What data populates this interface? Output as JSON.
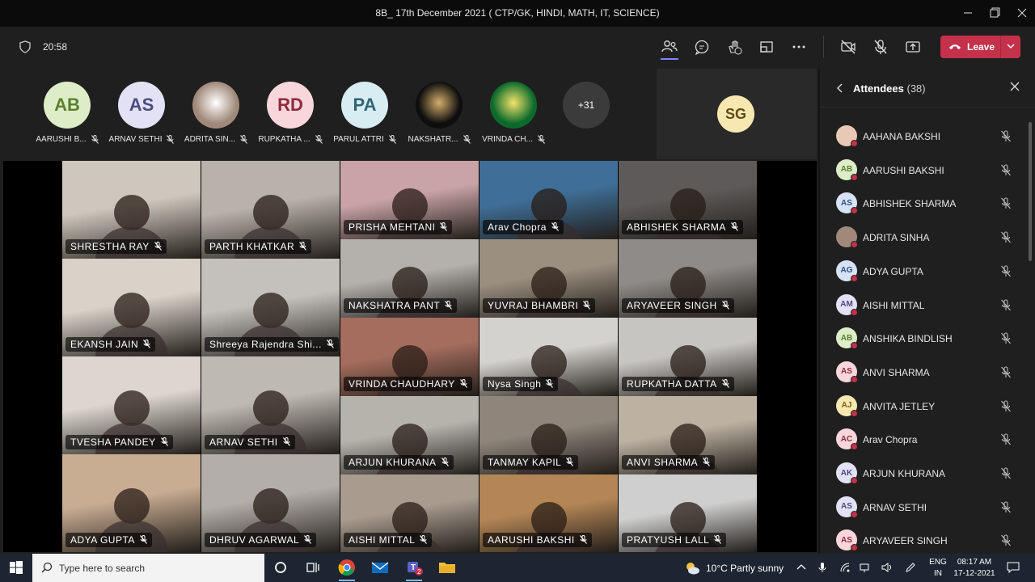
{
  "window": {
    "title": "8B_ 17th December 2021 ( CTP/GK, HINDI, MATH, IT, SCIENCE)"
  },
  "toolbar": {
    "timer": "20:58",
    "leave_label": "Leave"
  },
  "strip": {
    "participants": [
      {
        "initials": "AB",
        "name": "AARUSHI B...",
        "bg": "#dcedc8",
        "fg": "#5a7f2e",
        "photo": false
      },
      {
        "initials": "AS",
        "name": "ARNAV SETHI",
        "bg": "#e3e1f5",
        "fg": "#4b4c7d",
        "photo": false
      },
      {
        "initials": "",
        "name": "ADRITA SIN...",
        "bg": "#a0897a",
        "fg": "#ffffff",
        "photo": true
      },
      {
        "initials": "RD",
        "name": "RUPKATHA ...",
        "bg": "#f9d6dc",
        "fg": "#8c2a3c",
        "photo": false
      },
      {
        "initials": "PA",
        "name": "PARUL ATTRI",
        "bg": "#d7edf2",
        "fg": "#326574",
        "photo": false
      },
      {
        "initials": "",
        "name": "NAKSHATR...",
        "bg": "#0e0e0e",
        "fg": "#d4ad6a",
        "photo": true
      },
      {
        "initials": "",
        "name": "VRINDA CH...",
        "bg": "#0c6a2c",
        "fg": "#f4e36a",
        "photo": true
      }
    ],
    "more_count": "+31",
    "self_initials": "SG"
  },
  "tiles": [
    {
      "name": "SHRESTHA RAY",
      "bg": "#cfc7bd"
    },
    {
      "name": "PARTH KHATKAR",
      "bg": "#b9b2ab"
    },
    {
      "name": "PRISHA MEHTANI",
      "bg": "#c9a3a6"
    },
    {
      "name": "Arav Chopra",
      "bg": "#3f6f98"
    },
    {
      "name": "ABHISHEK SHARMA",
      "bg": "#5d5a59"
    },
    {
      "name": "EKANSH JAIN",
      "bg": "#d8d2c8"
    },
    {
      "name": "Shreeya Rajendra Shi...",
      "bg": "#c4c0bb"
    },
    {
      "name": "NAKSHATRA PANT",
      "bg": "#b4b0ab"
    },
    {
      "name": "YUVRAJ BHAMBRI",
      "bg": "#9b8f80"
    },
    {
      "name": "ARYAVEER SINGH",
      "bg": "#8e8b88"
    },
    {
      "name": "VRINDA CHAUDHARY",
      "bg": "#a56d5d"
    },
    {
      "name": "Nysa Singh",
      "bg": "#d4d2ce"
    },
    {
      "name": "RUPKATHA DATTA",
      "bg": "#c7c5c2"
    },
    {
      "name": "TVESHA PANDEY",
      "bg": "#dcd6cf"
    },
    {
      "name": "ARNAV SETHI",
      "bg": "#bfb9b3"
    },
    {
      "name": "ARJUN KHURANA",
      "bg": "#b6b3ad"
    },
    {
      "name": "TANMAY KAPIL",
      "bg": "#8f857b"
    },
    {
      "name": "ANVI SHARMA",
      "bg": "#bdb1a2"
    },
    {
      "name": "ADYA GUPTA",
      "bg": "#c9ad93"
    },
    {
      "name": "DHRUV AGARWAL",
      "bg": "#b3aea9"
    },
    {
      "name": "AISHI MITTAL",
      "bg": "#a99c8f"
    },
    {
      "name": "AARUSHI BAKSHI",
      "bg": "#b48656"
    },
    {
      "name": "PRATYUSH LALL",
      "bg": "#cfcfcf"
    }
  ],
  "attendees": {
    "title": "Attendees",
    "count": "(38)",
    "list": [
      {
        "initials": "",
        "name": "AAHANA BAKSHI",
        "bg": "#e9c9b6",
        "fg": "#7a4a2e"
      },
      {
        "initials": "AB",
        "name": "AARUSHI BAKSHI",
        "bg": "#dcedc8",
        "fg": "#5a7f2e"
      },
      {
        "initials": "AS",
        "name": "ABHISHEK SHARMA",
        "bg": "#d7e3f5",
        "fg": "#2f4f7f"
      },
      {
        "initials": "",
        "name": "ADRITA SINHA",
        "bg": "#a0897a",
        "fg": "#ffffff"
      },
      {
        "initials": "AG",
        "name": "ADYA GUPTA",
        "bg": "#d7e3f5",
        "fg": "#2f4f7f"
      },
      {
        "initials": "AM",
        "name": "AISHI MITTAL",
        "bg": "#e3e1f5",
        "fg": "#4b4c7d"
      },
      {
        "initials": "AB",
        "name": "ANSHIKA BINDLISH",
        "bg": "#dcedc8",
        "fg": "#5a7f2e"
      },
      {
        "initials": "AS",
        "name": "ANVI SHARMA",
        "bg": "#f9d6dc",
        "fg": "#8c2a3c"
      },
      {
        "initials": "AJ",
        "name": "ANVITA JETLEY",
        "bg": "#f7e7b1",
        "fg": "#7a5f14"
      },
      {
        "initials": "AC",
        "name": "Arav Chopra",
        "bg": "#f9d6dc",
        "fg": "#8c2a3c"
      },
      {
        "initials": "AK",
        "name": "ARJUN KHURANA",
        "bg": "#e3e1f5",
        "fg": "#4b4c7d"
      },
      {
        "initials": "AS",
        "name": "ARNAV SETHI",
        "bg": "#e3e1f5",
        "fg": "#4b4c7d"
      },
      {
        "initials": "AS",
        "name": "ARYAVEER SINGH",
        "bg": "#f9d6dc",
        "fg": "#8c2a3c"
      }
    ]
  },
  "taskbar": {
    "search_placeholder": "Type here to search",
    "weather": "10°C  Partly sunny",
    "lang_line1": "ENG",
    "lang_line2": "IN",
    "time": "08:17 AM",
    "date": "17-12-2021",
    "teams_badge": "2"
  },
  "colors": {
    "leave": "#c4314b",
    "accent": "#7f85f5",
    "status_busy": "#c4314b"
  }
}
